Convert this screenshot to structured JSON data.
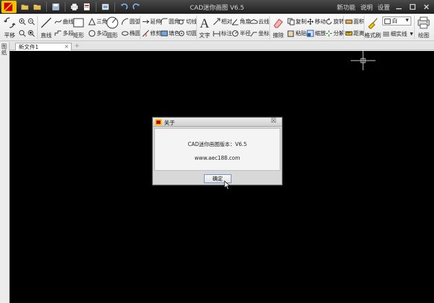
{
  "titlebar": {
    "title": "CAD迷你画图 V6.5",
    "menu": [
      "新功能",
      "说明",
      "设置"
    ],
    "quick_access": [
      "open-icon",
      "folder-icon",
      "save-icon",
      "print-icon",
      "print-preview-icon",
      "export-icon",
      "undo-icon",
      "redo-icon"
    ]
  },
  "ribbon": {
    "pan": "平移",
    "line": "直线",
    "polyline": "曲线",
    "multiline": "多段",
    "rect": "矩形",
    "triangle": "三角",
    "polygon": "多边",
    "circle": "圆形",
    "arc": "圆弧",
    "ellipse": "椭圆",
    "extend": "延伸",
    "trim": "修剪",
    "fillet": "圆角",
    "hatch": "填色",
    "cut": "切线",
    "cut2": "切圆",
    "text": "文字",
    "relative": "相对",
    "angle": "角度",
    "cloud": "云线",
    "dim_linear": "标注",
    "radius": "半径",
    "coord": "坐标",
    "erase": "擦除",
    "copy": "复制",
    "paste": "粘贴",
    "move": "移动",
    "scale": "缩放",
    "rotate": "旋转",
    "explode": "分解",
    "measure_area": "面积",
    "measure_len": "距离",
    "format_brush": "格式刷",
    "color_value": "白",
    "linetype_value": "细实线",
    "print": "绘图"
  },
  "sidetab": "图纸",
  "tabs": {
    "doc_title": "新文件1",
    "close": "×",
    "new_tab": "+"
  },
  "dialog": {
    "title": "关于",
    "close": "☒",
    "version_line": "CAD迷你画图版本：V6.5",
    "website": "www.aec188.com",
    "ok": "确定"
  },
  "colors": {
    "canvas": "#000000",
    "titlebar": "#2b2b2b",
    "accent": "#f2c200"
  }
}
